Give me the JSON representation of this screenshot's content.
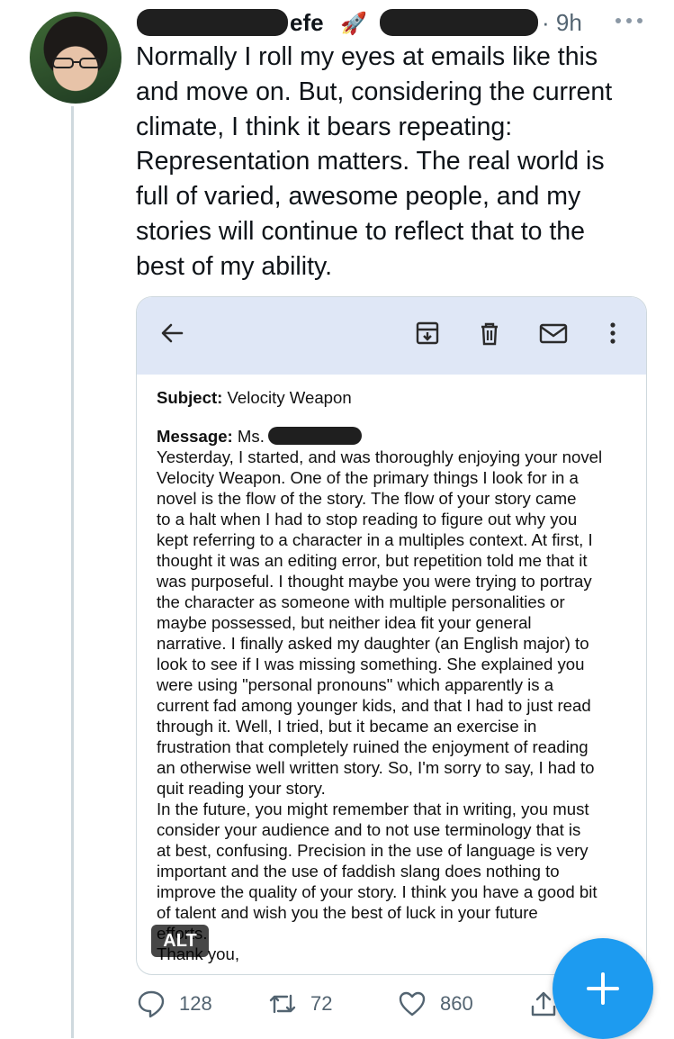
{
  "tweet": {
    "handle_suffix": "efe",
    "emoji": "🚀",
    "separator_time": "· 9h",
    "text": "Normally I roll my eyes at emails like this\nand move on. But, considering the current\nclimate, I think it bears repeating:\nRepresentation matters. The real world is\nfull of varied, awesome people, and my\nstories will continue to reflect that to the\nbest of my ability."
  },
  "email": {
    "subject_label": "Subject:",
    "subject_value": "Velocity Weapon",
    "message_label": "Message:",
    "salutation": "Ms.",
    "body": "Yesterday, I started, and was thoroughly enjoying your novel\nVelocity Weapon. One of the primary things I look for in a\nnovel is the flow of the story. The flow of your story came\nto a halt when I had to stop reading to figure out why you\nkept referring to a character in a multiples context. At first, I\nthought it was an editing error, but repetition told me that it\nwas purposeful. I thought maybe you were trying to portray\nthe character as someone with multiple personalities or\nmaybe possessed, but neither idea fit your general\nnarrative. I finally asked my daughter (an English major) to\nlook to see if I was missing something. She explained you\nwere using \"personal pronouns\" which apparently is a\ncurrent fad among younger kids, and that I had to just read\nthrough it. Well, I tried, but it became an exercise in\nfrustration that completely ruined the enjoyment of reading\nan otherwise well written story. So, I'm sorry to say, I had to\nquit reading your story.\nIn the future, you might remember that in writing, you must\nconsider your audience and to not use terminology that is\nat best, confusing. Precision in the use of language is very\nimportant and the use of faddish slang does nothing to\nimprove the quality of your story. I think you have a good bit\nof talent and wish you the best of luck in your future\nefforts.\nThank you,"
  },
  "alt_badge": "ALT",
  "actions": {
    "reply_count": "128",
    "retweet_count": "72",
    "like_count": "860"
  },
  "icons": [
    "avatar",
    "rocket-emoji",
    "more-icon",
    "back-arrow-icon",
    "archive-icon",
    "trash-icon",
    "mail-icon",
    "more-vertical-icon",
    "reply-icon",
    "retweet-icon",
    "like-icon",
    "share-icon",
    "compose-plus-icon"
  ],
  "colors": {
    "accent": "#1d9bf0",
    "muted": "#536471",
    "email_toolbar": "#dfe7f6"
  }
}
